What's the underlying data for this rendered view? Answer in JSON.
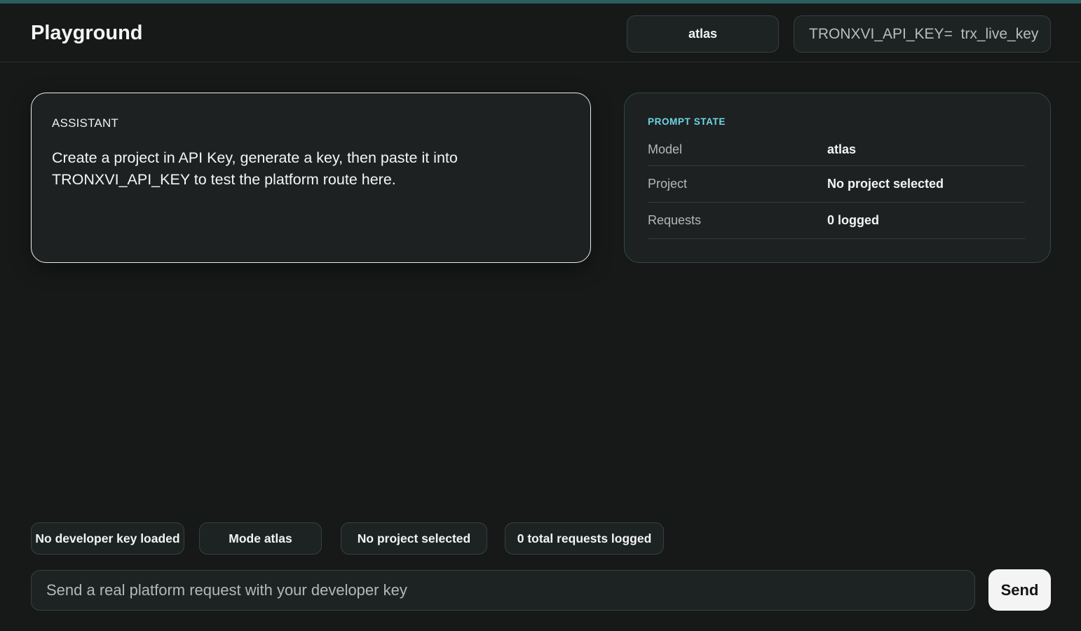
{
  "header": {
    "title": "Playground",
    "model_selected": "atlas",
    "api_key_field_value": "TRONXVI_API_KEY=  trx_live_key"
  },
  "assistant": {
    "role_label": "ASSISTANT",
    "message": "Create a project in API Key, generate a key, then paste it into TRONXVI_API_KEY to test the platform route here."
  },
  "prompt_state": {
    "heading": "PROMPT STATE",
    "rows": [
      {
        "label": "Model",
        "value": "atlas"
      },
      {
        "label": "Project",
        "value": "No project selected"
      },
      {
        "label": "Requests",
        "value": "0 logged"
      }
    ]
  },
  "status_chips": [
    "No developer key loaded",
    "Mode atlas",
    "No project selected",
    "0 total requests logged"
  ],
  "composer": {
    "placeholder": "Send a real platform request with your developer key",
    "send_label": "Send"
  },
  "colors": {
    "background": "#161918",
    "accent": "#2a5f5f",
    "state_heading": "#6dd6e6",
    "send_button": "#f3f4f3"
  }
}
